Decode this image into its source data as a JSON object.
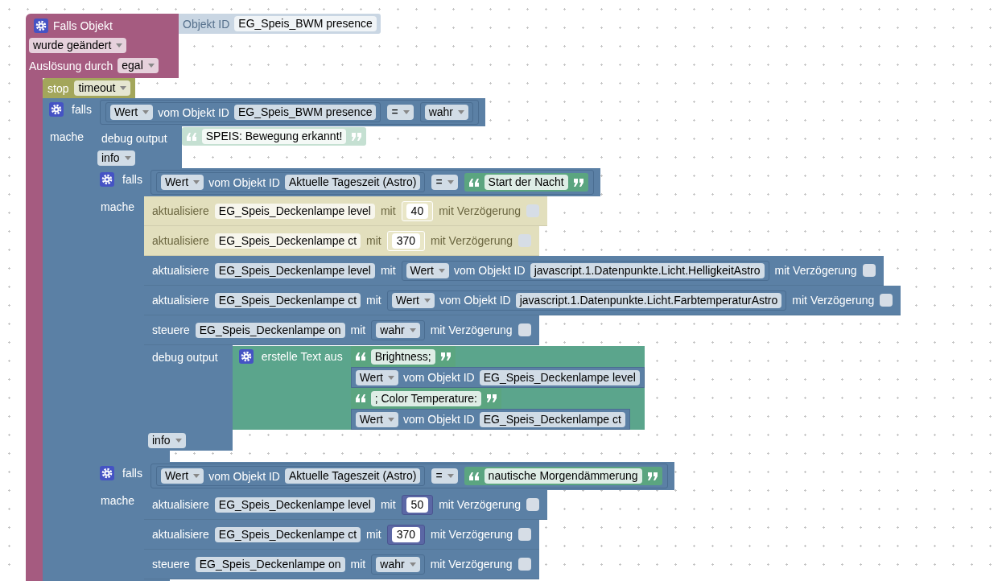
{
  "workspace": {
    "trigger": {
      "title": "Falls Objekt",
      "object": {
        "label": "Objekt ID",
        "id": "EG_Speis_BWM presence",
        "shadow": true
      },
      "event": "wurde geändert",
      "trigger_label": "Auslösung durch",
      "trigger_value": "egal",
      "statements": [
        {
          "kind": "stop",
          "label": "stop",
          "value": "timeout"
        },
        {
          "kind": "if",
          "label": "falls",
          "condition": {
            "kind": "compare",
            "left": {
              "kind": "get",
              "mode": "Wert",
              "label": "vom Objekt ID",
              "object": "EG_Speis_BWM presence"
            },
            "op": "=",
            "right": {
              "kind": "bool",
              "value": "wahr"
            }
          },
          "do_label": "mache",
          "body": [
            {
              "kind": "debug",
              "label": "debug output",
              "level": "info",
              "value": {
                "kind": "text",
                "value": "SPEIS: Bewegung erkannt!",
                "shadow": true
              }
            },
            {
              "kind": "if",
              "label": "falls",
              "condition": {
                "kind": "compare",
                "left": {
                  "kind": "get",
                  "mode": "Wert",
                  "label": "vom Objekt ID",
                  "object": "Aktuelle Tageszeit (Astro)"
                },
                "op": "=",
                "right": {
                  "kind": "text",
                  "value": "Start der Nacht",
                  "shadow": false
                }
              },
              "do_label": "mache",
              "body": [
                {
                  "kind": "update",
                  "label": "aktualisiere",
                  "target": "EG_Speis_Deckenlampe level",
                  "with": "mit",
                  "value": {
                    "kind": "number",
                    "value": "40"
                  },
                  "delay_label": "mit Verzögerung",
                  "delay": false,
                  "disabled": true
                },
                {
                  "kind": "update",
                  "label": "aktualisiere",
                  "target": "EG_Speis_Deckenlampe ct",
                  "with": "mit",
                  "value": {
                    "kind": "number",
                    "value": "370"
                  },
                  "delay_label": "mit Verzögerung",
                  "delay": false,
                  "disabled": true
                },
                {
                  "kind": "update",
                  "label": "aktualisiere",
                  "target": "EG_Speis_Deckenlampe level",
                  "with": "mit",
                  "value": {
                    "kind": "get",
                    "mode": "Wert",
                    "label": "vom Objekt ID",
                    "object": "javascript.1.Datenpunkte.Licht.HelligkeitAstro"
                  },
                  "delay_label": "mit Verzögerung",
                  "delay": false,
                  "disabled": false
                },
                {
                  "kind": "update",
                  "label": "aktualisiere",
                  "target": "EG_Speis_Deckenlampe ct",
                  "with": "mit",
                  "value": {
                    "kind": "get",
                    "mode": "Wert",
                    "label": "vom Objekt ID",
                    "object": "javascript.1.Datenpunkte.Licht.FarbtemperaturAstro"
                  },
                  "delay_label": "mit Verzögerung",
                  "delay": false,
                  "disabled": false
                },
                {
                  "kind": "control",
                  "label": "steuere",
                  "target": "EG_Speis_Deckenlampe on",
                  "with": "mit",
                  "value": {
                    "kind": "bool",
                    "value": "wahr"
                  },
                  "delay_label": "mit Verzögerung",
                  "delay": false,
                  "disabled": false
                },
                {
                  "kind": "debug",
                  "label": "debug output",
                  "level": "info",
                  "value": {
                    "kind": "join",
                    "label": "erstelle Text aus",
                    "items": [
                      {
                        "kind": "text",
                        "value": "Brightness;",
                        "shadow": false
                      },
                      {
                        "kind": "get",
                        "mode": "Wert",
                        "label": "vom Objekt ID",
                        "object": "EG_Speis_Deckenlampe level"
                      },
                      {
                        "kind": "text",
                        "value": "; Color Temperature:",
                        "shadow": false
                      },
                      {
                        "kind": "get",
                        "mode": "Wert",
                        "label": "vom Objekt ID",
                        "object": "EG_Speis_Deckenlampe ct"
                      }
                    ]
                  }
                }
              ]
            },
            {
              "kind": "if",
              "label": "falls",
              "condition": {
                "kind": "compare",
                "left": {
                  "kind": "get",
                  "mode": "Wert",
                  "label": "vom Objekt ID",
                  "object": "Aktuelle Tageszeit (Astro)"
                },
                "op": "=",
                "right": {
                  "kind": "text",
                  "value": "nautische Morgendämmerung",
                  "shadow": false
                }
              },
              "do_label": "mache",
              "body": [
                {
                  "kind": "update",
                  "label": "aktualisiere",
                  "target": "EG_Speis_Deckenlampe level",
                  "with": "mit",
                  "value": {
                    "kind": "number",
                    "value": "50"
                  },
                  "delay_label": "mit Verzögerung",
                  "delay": false,
                  "disabled": false
                },
                {
                  "kind": "update",
                  "label": "aktualisiere",
                  "target": "EG_Speis_Deckenlampe ct",
                  "with": "mit",
                  "value": {
                    "kind": "number",
                    "value": "370"
                  },
                  "delay_label": "mit Verzögerung",
                  "delay": false,
                  "disabled": false
                },
                {
                  "kind": "control",
                  "label": "steuere",
                  "target": "EG_Speis_Deckenlampe on",
                  "with": "mit",
                  "value": {
                    "kind": "bool",
                    "value": "wahr"
                  },
                  "delay_label": "mit Verzögerung",
                  "delay": false,
                  "disabled": false
                }
              ]
            }
          ]
        }
      ]
    }
  }
}
